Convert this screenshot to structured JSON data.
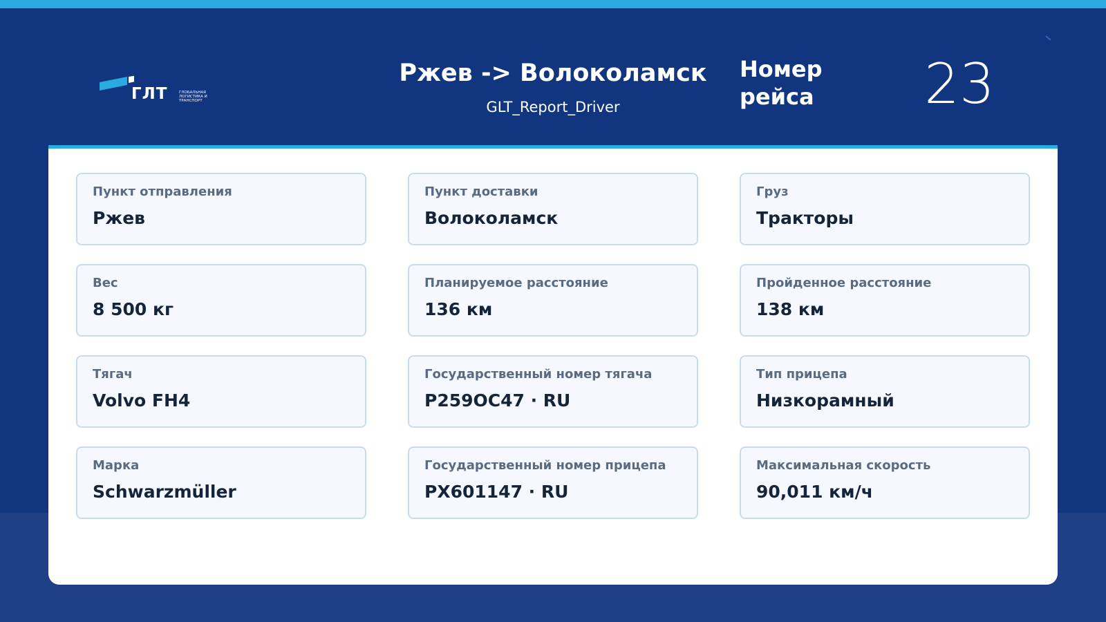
{
  "brand": {
    "logo_text": "ГЛТ",
    "tagline": "ГЛОБАЛЬНАЯ ЛОГИСТИКА И ТРАНСПОРТ",
    "accent_color": "#29abe2",
    "background_color": "#12357f"
  },
  "header": {
    "route": "Ржев -> Волоколамск",
    "report_name": "GLT_Report_Driver",
    "trip_label": "Номер рейса",
    "trip_number": "23"
  },
  "fields": [
    {
      "label": "Пункт отправления",
      "value": "Ржев"
    },
    {
      "label": "Пункт доставки",
      "value": "Волоколамск"
    },
    {
      "label": "Груз",
      "value": "Тракторы"
    },
    {
      "label": "Вес",
      "value": "8 500 кг"
    },
    {
      "label": "Планируемое расстояние",
      "value": "136 км"
    },
    {
      "label": "Пройденное расстояние",
      "value": "138 км"
    },
    {
      "label": "Тягач",
      "value": "Volvo FH4"
    },
    {
      "label": "Государственный номер тягача",
      "value": "Р259ОС47 · RU"
    },
    {
      "label": "Тип прицепа",
      "value": "Низкорамный"
    },
    {
      "label": "Марка",
      "value": "Schwarzmüller"
    },
    {
      "label": "Государственный номер прицепа",
      "value": "РХ601147 · RU"
    },
    {
      "label": "Максимальная скорость",
      "value": "90,011 км/ч"
    }
  ]
}
